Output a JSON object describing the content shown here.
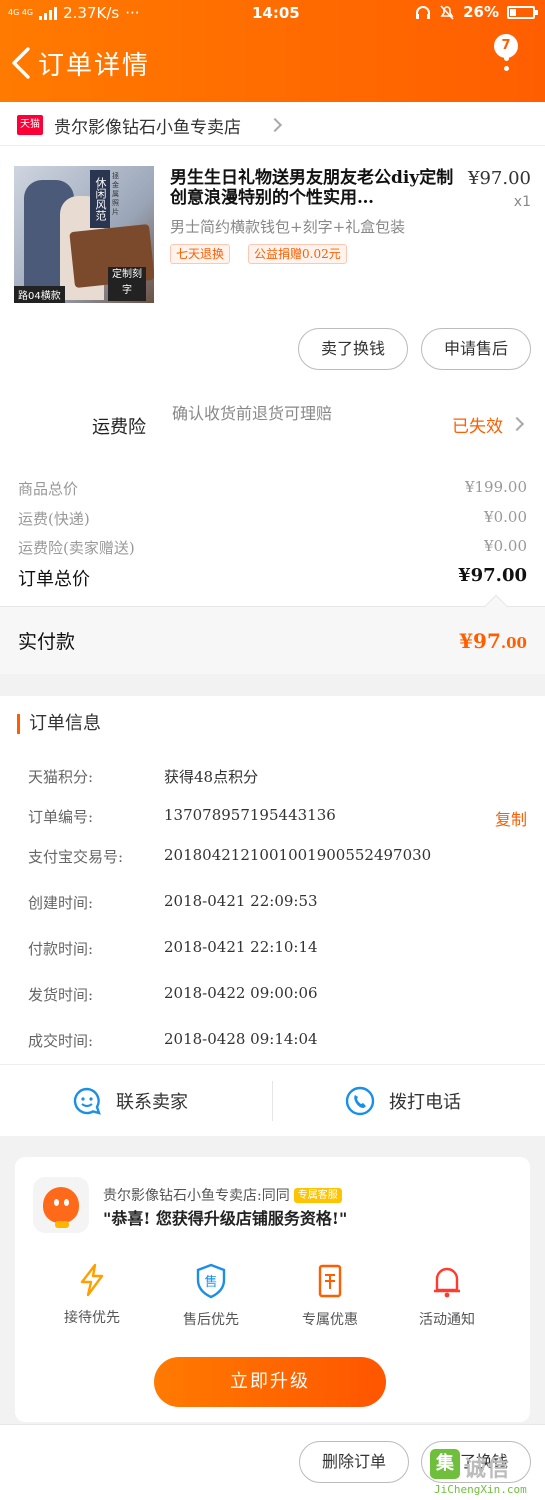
{
  "status_bar": {
    "network": "4G 4G",
    "speed": "2.37K/s",
    "dots": "···",
    "time": "14:05",
    "battery": "26%",
    "battery_level": 0.26
  },
  "header": {
    "title": "订单详情",
    "message_count": "7"
  },
  "shop": {
    "platform_badge": "天猫",
    "name": "贵尔影像钻石小鱼专卖店"
  },
  "product": {
    "title": "男生生日礼物送男友朋友老公diy定制创意浪漫特别的个性实用…",
    "price": "¥97.00",
    "quantity": "x1",
    "sku": "男士简约横款钱包+刻字+礼盒包装",
    "tags": [
      "七天退换",
      "公益捐赠0.02元"
    ],
    "image_labels": {
      "vertical": "休闲风范",
      "small": "拯金属照片",
      "bottom_left": "路04横款",
      "bottom_right": "定制刻字"
    }
  },
  "product_actions": {
    "sell_label": "卖了换钱",
    "after_sale_label": "申请售后"
  },
  "shipping_insurance": {
    "label": "运费险",
    "description": "确认收货前退货可理赔",
    "status": "已失效"
  },
  "summary": {
    "goods_total_label": "商品总价",
    "goods_total": "¥199.00",
    "shipping_label": "运费(快递)",
    "shipping": "¥0.00",
    "insurance_label": "运费险(卖家赠送)",
    "insurance": "¥0.00",
    "order_total_label": "订单总价",
    "order_total": "¥97.00"
  },
  "paid": {
    "label": "实付款",
    "value_main": "¥97",
    "value_cents": ".00"
  },
  "order_info": {
    "title": "订单信息",
    "copy_label": "复制",
    "rows": [
      {
        "k": "天猫积分:",
        "v": "获得48点积分"
      },
      {
        "k": "订单编号:",
        "v": "137078957195443136"
      },
      {
        "k": "支付宝交易号:",
        "v": "2018042121001001900552497030"
      },
      {
        "k": "创建时间:",
        "v": "2018-0421 22:09:53"
      },
      {
        "k": "付款时间:",
        "v": "2018-0421 22:10:14"
      },
      {
        "k": "发货时间:",
        "v": "2018-0422 09:00:06"
      },
      {
        "k": "成交时间:",
        "v": "2018-0428 09:14:04"
      }
    ]
  },
  "contact": {
    "seller_label": "联系卖家",
    "call_label": "拨打电话"
  },
  "upgrade_card": {
    "shop_line": "贵尔影像钻石小鱼专卖店:同同",
    "exclusive_badge": "专属客服",
    "message": "\"恭喜! 您获得升级店铺服务资格!\"",
    "perks": [
      "接待优先",
      "售后优先",
      "专属优惠",
      "活动通知"
    ],
    "upgrade_label": "立即升级"
  },
  "bottom_bar": {
    "delete_label": "删除订单",
    "sell_label": "卖了换钱"
  },
  "watermark": {
    "logo": "集",
    "text": "诚信",
    "url": "JiChengXin.com"
  },
  "colors": {
    "accent": "#ff5e00",
    "header_start": "#ff7a00",
    "tmall_red": "#ff0036",
    "link_blue": "#1a8fe8"
  }
}
